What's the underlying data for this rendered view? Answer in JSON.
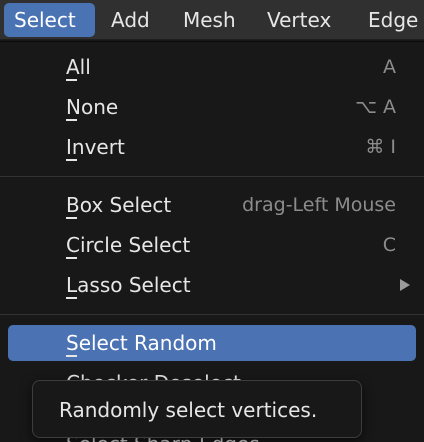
{
  "menubar": {
    "items": [
      "Select",
      "Add",
      "Mesh",
      "Vertex",
      "Edge"
    ],
    "active": "Select",
    "active_color": "#4a73b3"
  },
  "menu": {
    "groups": [
      [
        {
          "label": "All",
          "shortcut": "A"
        },
        {
          "label": "None",
          "shortcut": "⌥ A"
        },
        {
          "label": "Invert",
          "shortcut": "⌘ I"
        }
      ],
      [
        {
          "label": "Box Select",
          "shortcut": "drag-Left Mouse"
        },
        {
          "label": "Circle Select",
          "shortcut": "C"
        },
        {
          "label": "Lasso Select",
          "shortcut": "",
          "submenu_icon": "submenu-arrow-icon"
        }
      ],
      [
        {
          "label": "Select Random",
          "shortcut": "",
          "highlighted": true
        },
        {
          "label": "Checker Deselect",
          "shortcut": ""
        },
        {
          "label": "Select Sharp Edges",
          "shortcut": ""
        }
      ]
    ],
    "highlight_color": "#4b72b3"
  },
  "tooltip": {
    "text": "Randomly select vertices."
  }
}
